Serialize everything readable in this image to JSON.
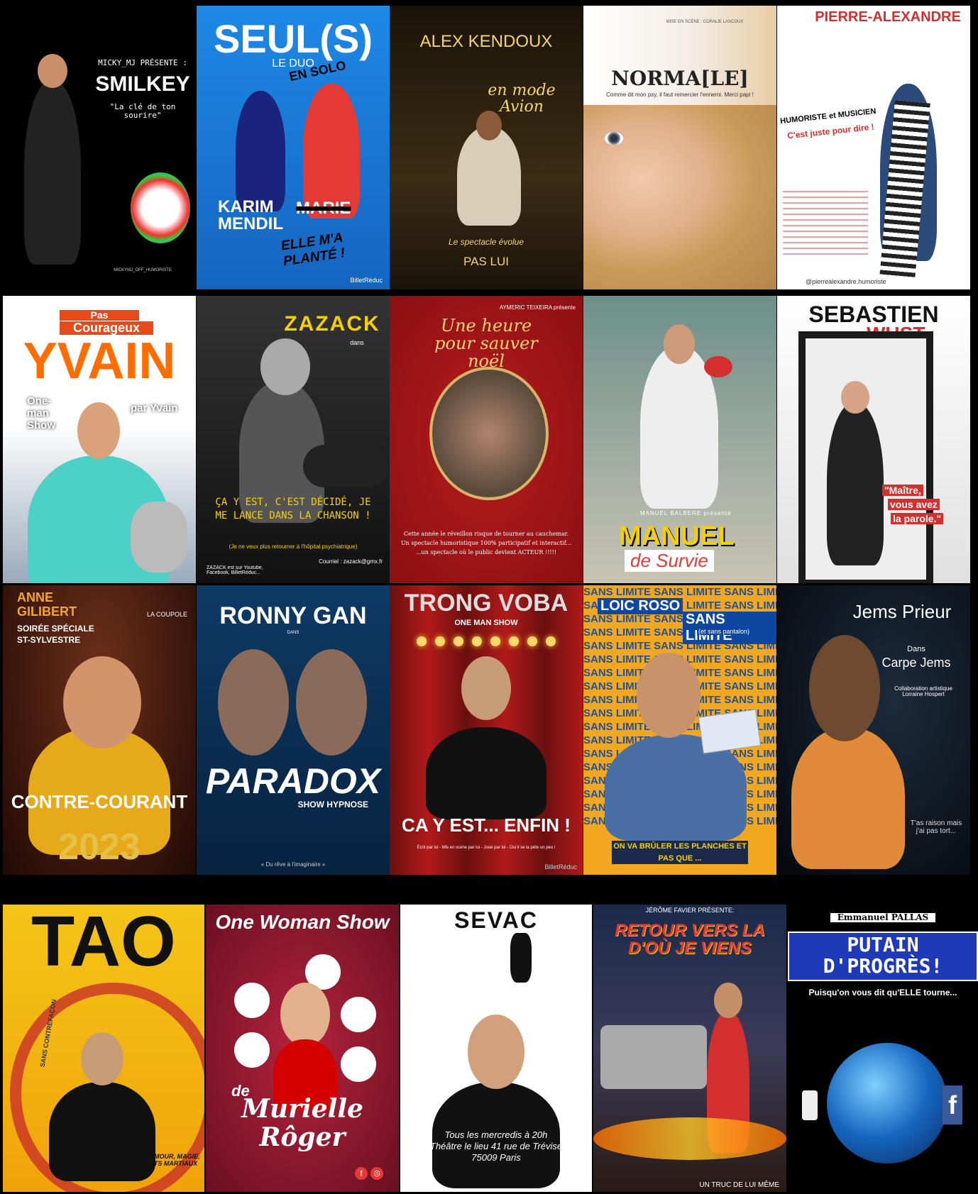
{
  "posters": [
    {
      "id": "smilkey",
      "presenter": "MICKY_MJ PRÉSENTE :",
      "title": "SMILKEY",
      "tagline": "\"La clé de ton sourire\"",
      "handle": "MICKYMJ_OFF_HUMORISTE"
    },
    {
      "id": "seuls",
      "title": "SEUL(S)",
      "subtitle": "LE DUO",
      "stamp": "EN SOLO",
      "name": "KARIM MENDIL",
      "crossed": "MARIE",
      "slogan": "ELLE M'A PLANTÉ !",
      "brand": "BilletRéduc"
    },
    {
      "id": "kendoux",
      "title": "ALEX KENDOUX",
      "subtitle": "en mode Avion",
      "tagline": "Le spectacle évolue",
      "footer": "PAS LUI"
    },
    {
      "id": "norma",
      "credit": "MISE EN SCÈNE : CORALIE LASCOUX",
      "title": "NORMA[LE]",
      "tagline": "Comme dit mon psy, il faut remercier l'ennemi. Merci papi !"
    },
    {
      "id": "pierre",
      "title": "PIERRE-ALEXANDRE",
      "subtitle": "HUMORISTE et MUSICIEN",
      "tagline": "C'est juste pour dire !",
      "handle": "@pierrealexandre.humoriste"
    },
    {
      "id": "yvain",
      "top": "Pas",
      "title2": "Courageux",
      "title": "YVAIN",
      "left": "One-man Show",
      "right": "par Yvain"
    },
    {
      "id": "zazack",
      "title": "ZAZACK",
      "dans": "dans",
      "text": "ÇA Y EST, C'EST DÉCIDÉ, JE ME LANCE DANS LA CHANSON !",
      "sub": "(Je ne veux plus retourner à l'hôpital psychiatrique)",
      "contact": "Courriel : zazack@gmx.fr",
      "footer": "ZAZACK est sur Youtube, Facebook, BilletRéduc..."
    },
    {
      "id": "noel",
      "presenter": "AYMERIC TEIXEIRA présente",
      "title": "Une heure pour sauver noël",
      "text": "Cette année le réveillon risque de tourner au cauchemar. Un spectacle humoristique 100% participatif et interactif... ...un spectacle où le public devient ACTEUR !!!!!"
    },
    {
      "id": "manuel",
      "presenter": "MANUEL BALBERE présente",
      "title": "MANUEL",
      "subtitle": "de Survie"
    },
    {
      "id": "sebastien",
      "title": "SEBASTIEN",
      "title2": "WUST",
      "quote1": "\"Maître,",
      "quote2": "vous avez",
      "quote3": "la parole.\""
    },
    {
      "id": "anne",
      "title": "ANNE GILIBERT",
      "subtitle": "SOIRÉE SPÉCIALE ST-SYLVESTRE",
      "venue": "LA COUPOLE",
      "show": "CONTRE-COURANT",
      "year": "2023"
    },
    {
      "id": "ronny",
      "title": "RONNY GAN",
      "dans": "DANS",
      "show": "PARADOX",
      "subtitle": "SHOW HYPNOSE",
      "tagline": "« Du rêve à l'imaginaire »"
    },
    {
      "id": "trong",
      "title": "TRONG VOBA",
      "subtitle": "ONE MAN SHOW",
      "show": "CA Y EST... ENFIN !",
      "credits": "Écrit par lui - Mis en scène par lui - Joué par lui - Oui il se la pète un peu !",
      "brand": "BilletRéduc"
    },
    {
      "id": "loic",
      "pattern": "SANS LIMITE",
      "title": "LOIC ROSO",
      "show": "SANS LIMITE",
      "aside": "(et sans pantalon)",
      "tagline": "ON VA BRÛLER LES PLANCHES ET PAS QUE ..."
    },
    {
      "id": "jems",
      "title": "Jems Prieur",
      "dans": "Dans",
      "show": "Carpe Jems",
      "collab": "Collaboration artistique Lorraine Hospert",
      "tagline": "T'as raison mais j'ai pas tort..."
    },
    {
      "id": "tao",
      "title": "TAO",
      "tag": "SANS CONTREFAÇON",
      "footer": "HUMOUR, MAGIE, ARTS MARTIAUX"
    },
    {
      "id": "murielle",
      "title": "One Woman Show",
      "de": "de",
      "name": "Murielle",
      "surname": "Rôger"
    },
    {
      "id": "sevac",
      "title": "SEVAC",
      "info1": "Tous les mercredis à 20h",
      "info2": "Théâtre le lieu 41 rue de Trévise",
      "info3": "75009 Paris"
    },
    {
      "id": "retour",
      "presenter": "JÉRÔME FAVIER PRÉSENTE:",
      "title": "RETOUR VERS LA D'OÙ JE VIENS",
      "footer": "UN TRUC DE LUI MÊME"
    },
    {
      "id": "pallas",
      "presenter": "Emmanuel PALLAS",
      "title1": "PUTAIN",
      "title2": "D'PROGRÈS!",
      "tagline": "Puisqu'on vous dit qu'ELLE tourne..."
    }
  ],
  "colors": {
    "bg": "#000000",
    "accent": "#f5a623"
  }
}
